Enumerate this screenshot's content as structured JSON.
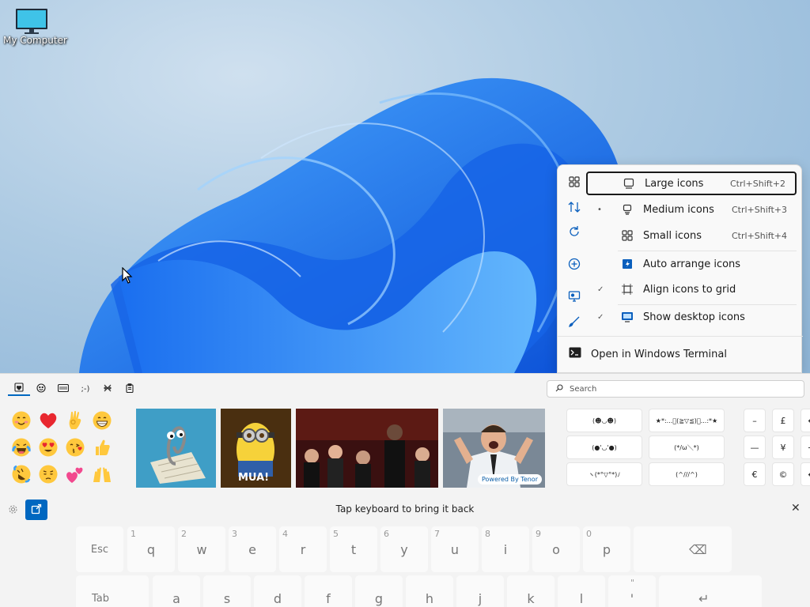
{
  "desktop": {
    "icon_label": "My Computer"
  },
  "context_menu": {
    "side_icons": [
      "grid-icon",
      "sort-icon",
      "refresh-icon",
      "new-icon",
      "display-settings-icon",
      "personalize-icon"
    ],
    "items": [
      {
        "label": "Large icons",
        "shortcut": "Ctrl+Shift+2",
        "mark": "",
        "icon": "large-icons-icon"
      },
      {
        "label": "Medium icons",
        "shortcut": "Ctrl+Shift+3",
        "mark": "•",
        "icon": "medium-icons-icon"
      },
      {
        "label": "Small icons",
        "shortcut": "Ctrl+Shift+4",
        "mark": "",
        "icon": "small-icons-icon"
      },
      {
        "label": "Auto arrange icons",
        "shortcut": "",
        "mark": "",
        "icon": "auto-arrange-icon"
      },
      {
        "label": "Align icons to grid",
        "shortcut": "",
        "mark": "✓",
        "icon": "align-grid-icon"
      },
      {
        "label": "Show desktop icons",
        "shortcut": "",
        "mark": "✓",
        "icon": "show-desktop-icon"
      }
    ],
    "terminal_label": "Open in Windows Terminal"
  },
  "emoji_panel": {
    "tabs": [
      "favorites-icon",
      "emoji-icon",
      "gif-icon",
      "kaomoji-icon",
      "symbols-icon",
      "clipboard-icon"
    ],
    "search_placeholder": "Search",
    "emojis": [
      "smiling-face",
      "red-heart",
      "ok-hand",
      "grinning-face",
      "joy-face",
      "heart-eyes-face",
      "kissing-face",
      "thumbs-up",
      "rofl-face",
      "pensive-face",
      "two-hearts",
      "raised-hands"
    ],
    "gifs": [
      {
        "name": "clippy-gif",
        "caption": ""
      },
      {
        "name": "minion-gif",
        "caption": "MUA!"
      },
      {
        "name": "awards-gif",
        "caption": ""
      },
      {
        "name": "cheering-gif",
        "caption": ""
      }
    ],
    "powered_by": "Powered By Tenor",
    "kaomoji": [
      "(☻◡☻)",
      "★*:...ﾟ(≧▽≦)ﾟ...:*★",
      "(●'◡'●)",
      "(*/ω＼*)",
      "ヽ(*°▽°*)ﾉ",
      "(^///^)"
    ],
    "symbols": [
      "–",
      "£",
      "←",
      "—",
      "¥",
      "→",
      "€",
      "©",
      "↔"
    ]
  },
  "keyboard": {
    "tip": "Tap keyboard to bring it back",
    "row1": [
      {
        "hint": "",
        "ch": "Esc"
      },
      {
        "hint": "1",
        "ch": "q"
      },
      {
        "hint": "2",
        "ch": "w"
      },
      {
        "hint": "3",
        "ch": "e"
      },
      {
        "hint": "4",
        "ch": "r"
      },
      {
        "hint": "5",
        "ch": "t"
      },
      {
        "hint": "6",
        "ch": "y"
      },
      {
        "hint": "7",
        "ch": "u"
      },
      {
        "hint": "8",
        "ch": "i"
      },
      {
        "hint": "9",
        "ch": "o"
      },
      {
        "hint": "0",
        "ch": "p"
      },
      {
        "hint": "",
        "ch": "⌫"
      }
    ],
    "row2": [
      {
        "hint": "",
        "ch": "Tab"
      },
      {
        "hint": "",
        "ch": "a"
      },
      {
        "hint": "",
        "ch": "s"
      },
      {
        "hint": "",
        "ch": "d"
      },
      {
        "hint": "",
        "ch": "f"
      },
      {
        "hint": "",
        "ch": "g"
      },
      {
        "hint": "",
        "ch": "h"
      },
      {
        "hint": "",
        "ch": "j"
      },
      {
        "hint": "",
        "ch": "k"
      },
      {
        "hint": "",
        "ch": "l"
      },
      {
        "hint": "\"",
        "ch": "'"
      },
      {
        "hint": "",
        "ch": "↵"
      }
    ]
  }
}
